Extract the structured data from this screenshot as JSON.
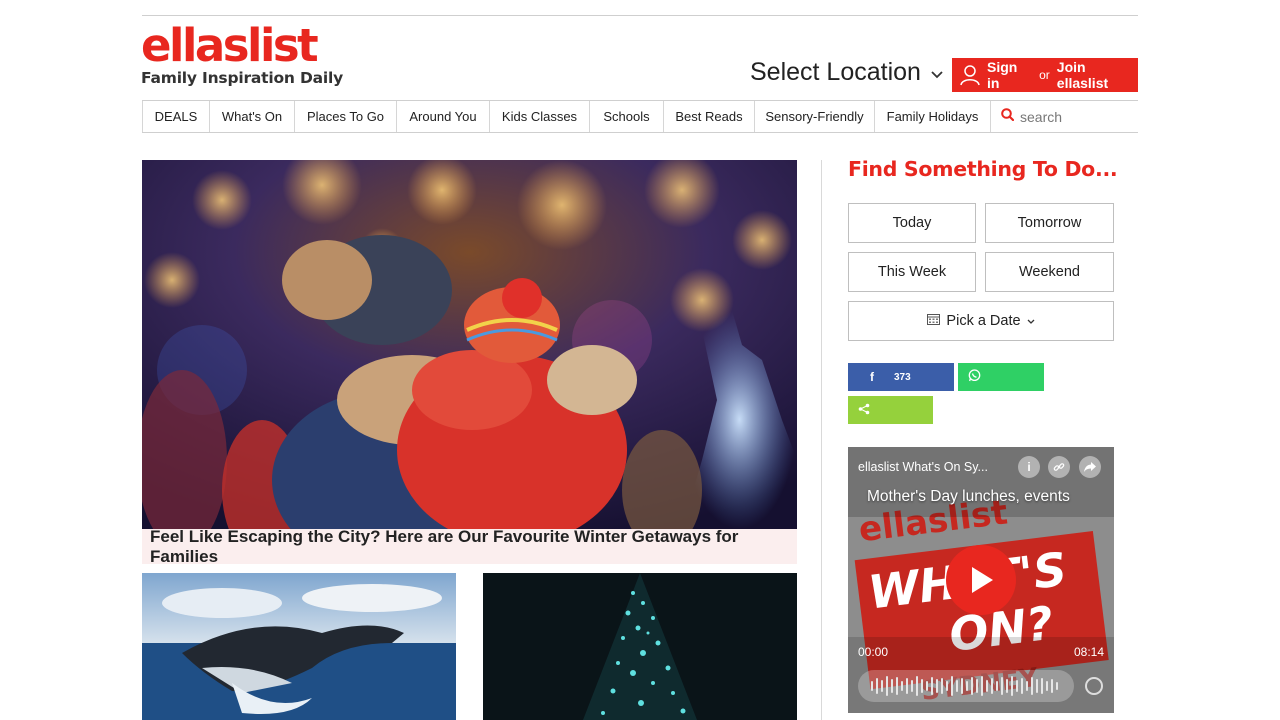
{
  "brand": {
    "logo_text": "ellaslist",
    "tagline": "Family Inspiration Daily",
    "accent_color": "#e8271f"
  },
  "header": {
    "location_label": "Select Location",
    "signin": {
      "sign_in": "Sign in",
      "or": "or",
      "join": "Join ellaslist"
    }
  },
  "nav": {
    "items": [
      {
        "label": "DEALS"
      },
      {
        "label": "What's On"
      },
      {
        "label": "Places To Go"
      },
      {
        "label": "Around You"
      },
      {
        "label": "Kids Classes"
      },
      {
        "label": "Schools"
      },
      {
        "label": "Best Reads"
      },
      {
        "label": "Sensory-Friendly"
      },
      {
        "label": "Family Holidays"
      }
    ],
    "search_placeholder": "search"
  },
  "main": {
    "hero_caption": "Feel Like Escaping the City? Here are Our Favourite Winter Getaways for Families"
  },
  "sidebar": {
    "find_title": "Find Something To Do...",
    "date_buttons": {
      "today": "Today",
      "tomorrow": "Tomorrow",
      "this_week": "This Week",
      "weekend": "Weekend",
      "pick_date": "Pick a Date"
    },
    "share": {
      "facebook_count": "373",
      "facebook_color": "#3b5ea9",
      "whatsapp_color": "#2fd065",
      "share_color": "#95d13c"
    },
    "player": {
      "channel_title": "ellaslist What's On Sy...",
      "episode_title": "Mother's Day lunches, events",
      "current_time": "00:00",
      "duration": "08:14",
      "art_text_1": "ellaslist",
      "art_text_2": "WHAT'S",
      "art_text_3": "ON?",
      "art_text_4": "SYDNEY"
    }
  }
}
